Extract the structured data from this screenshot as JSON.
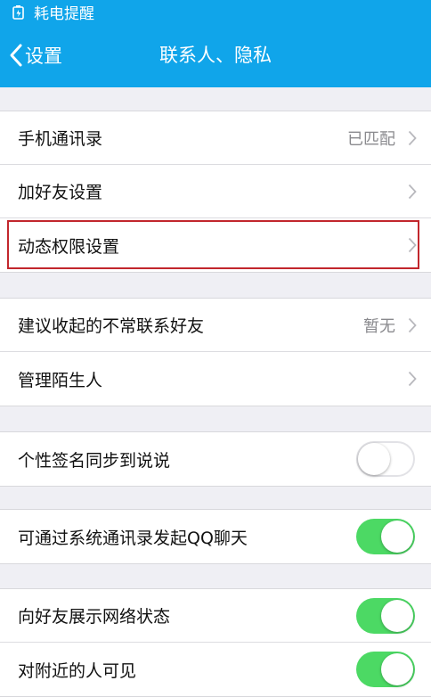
{
  "status_bar": {
    "text": "耗电提醒",
    "icon": "battery-saver-icon"
  },
  "nav": {
    "back_label": "设置",
    "title": "联系人、隐私"
  },
  "group1": [
    {
      "label": "手机通讯录",
      "value": "已匹配"
    },
    {
      "label": "加好友设置",
      "value": ""
    },
    {
      "label": "动态权限设置",
      "value": "",
      "highlighted": true
    }
  ],
  "group2": [
    {
      "label": "建议收起的不常联系好友",
      "value": "暂无"
    },
    {
      "label": "管理陌生人",
      "value": ""
    }
  ],
  "toggles": {
    "signature_sync": {
      "label": "个性签名同步到说说",
      "on": false
    },
    "contacts_qq_chat": {
      "label": "可通过系统通讯录发起QQ聊天",
      "on": true
    },
    "show_network": {
      "label": "向好友展示网络状态",
      "on": true
    },
    "visible_nearby": {
      "label": "对附近的人可见",
      "on": true
    }
  },
  "colors": {
    "accent": "#10a5ea",
    "toggle_on": "#4cd964",
    "highlight": "#c2272d"
  }
}
